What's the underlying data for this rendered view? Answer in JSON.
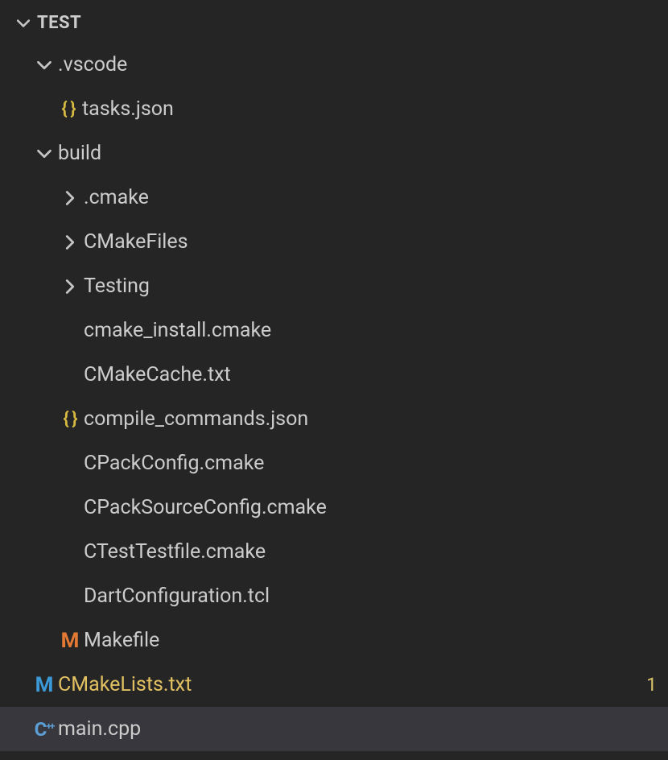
{
  "section": {
    "title": "TEST"
  },
  "tree": {
    "vscode": {
      "label": ".vscode",
      "tasksjson": "tasks.json"
    },
    "build": {
      "label": "build",
      "cmake": ".cmake",
      "cmakefiles": "CMakeFiles",
      "testing": "Testing",
      "cmake_install": "cmake_install.cmake",
      "cmakecache": "CMakeCache.txt",
      "compile_commands": "compile_commands.json",
      "cpackconfig": "CPackConfig.cmake",
      "cpacksourceconfig": "CPackSourceConfig.cmake",
      "ctesttestfile": "CTestTestfile.cmake",
      "dartconfig": "DartConfiguration.tcl",
      "makefile": "Makefile"
    },
    "cmakelists": {
      "label": "CMakeLists.txt",
      "badge": "1"
    },
    "maincpp": "main.cpp"
  },
  "icons": {
    "json_braces": "{ }",
    "makefile_m": "M",
    "cmake_m": "M",
    "cpp": "C⁺⁺"
  }
}
